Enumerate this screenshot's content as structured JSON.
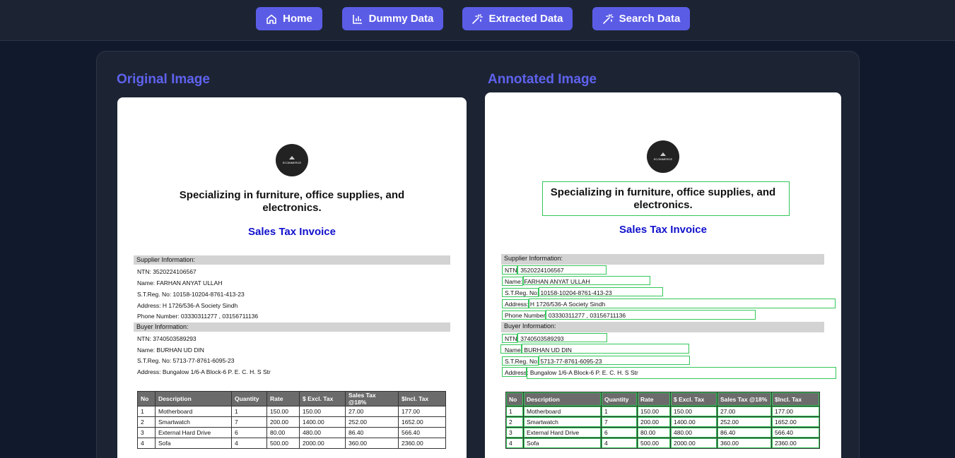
{
  "nav": {
    "home": "Home",
    "dummy": "Dummy Data",
    "extracted": "Extracted Data",
    "search": "Search Data"
  },
  "sections": {
    "original": "Original Image",
    "annotated": "Annotated Image"
  },
  "invoice": {
    "logo_text": "ECOMMERCE",
    "tagline_1": "Specializing in furniture, office supplies, and",
    "tagline_2": "electronics.",
    "title": "Sales Tax Invoice",
    "supplier_header": "Supplier Information:",
    "supplier_ntn": "NTN: 3520224106567",
    "supplier_name": "Name: FARHAN ANYAT ULLAH",
    "supplier_streg": "S.T.Reg. No: 10158-10204-8761-413-23",
    "supplier_address": "Address: H 1726/536-A Society Sindh",
    "supplier_phone": "Phone Number: 03330311277  ,   03156711136",
    "buyer_header": "Buyer Information:",
    "buyer_ntn": "NTN: 3740503589293",
    "buyer_name": "Name: BURHAN UD DIN",
    "buyer_streg": "S.T.Reg. No: 5713-77-8761-6095-23",
    "buyer_address": "Address: Bungalow 1/6-A Block-6 P. E. C. H. S Str",
    "table": {
      "headers": [
        "No",
        "Description",
        "Quantity",
        "Rate",
        "$ Excl. Tax",
        "Sales Tax @18%",
        "$Incl. Tax"
      ],
      "rows": [
        [
          "1",
          "Motherboard",
          "1",
          "150.00",
          "150.00",
          "27.00",
          "177.00"
        ],
        [
          "2",
          "Smartwatch",
          "7",
          "200.00",
          "1400.00",
          "252.00",
          "1652.00"
        ],
        [
          "3",
          "External Hard Drive",
          "6",
          "80.00",
          "480.00",
          "86.40",
          "566.40"
        ],
        [
          "4",
          "Sofa",
          "4",
          "500.00",
          "2000.00",
          "360.00",
          "2360.00"
        ]
      ]
    }
  },
  "colors": {
    "accent": "#5b5ce6",
    "title_blue": "#1010cc",
    "annotation_green": "#34c759"
  }
}
